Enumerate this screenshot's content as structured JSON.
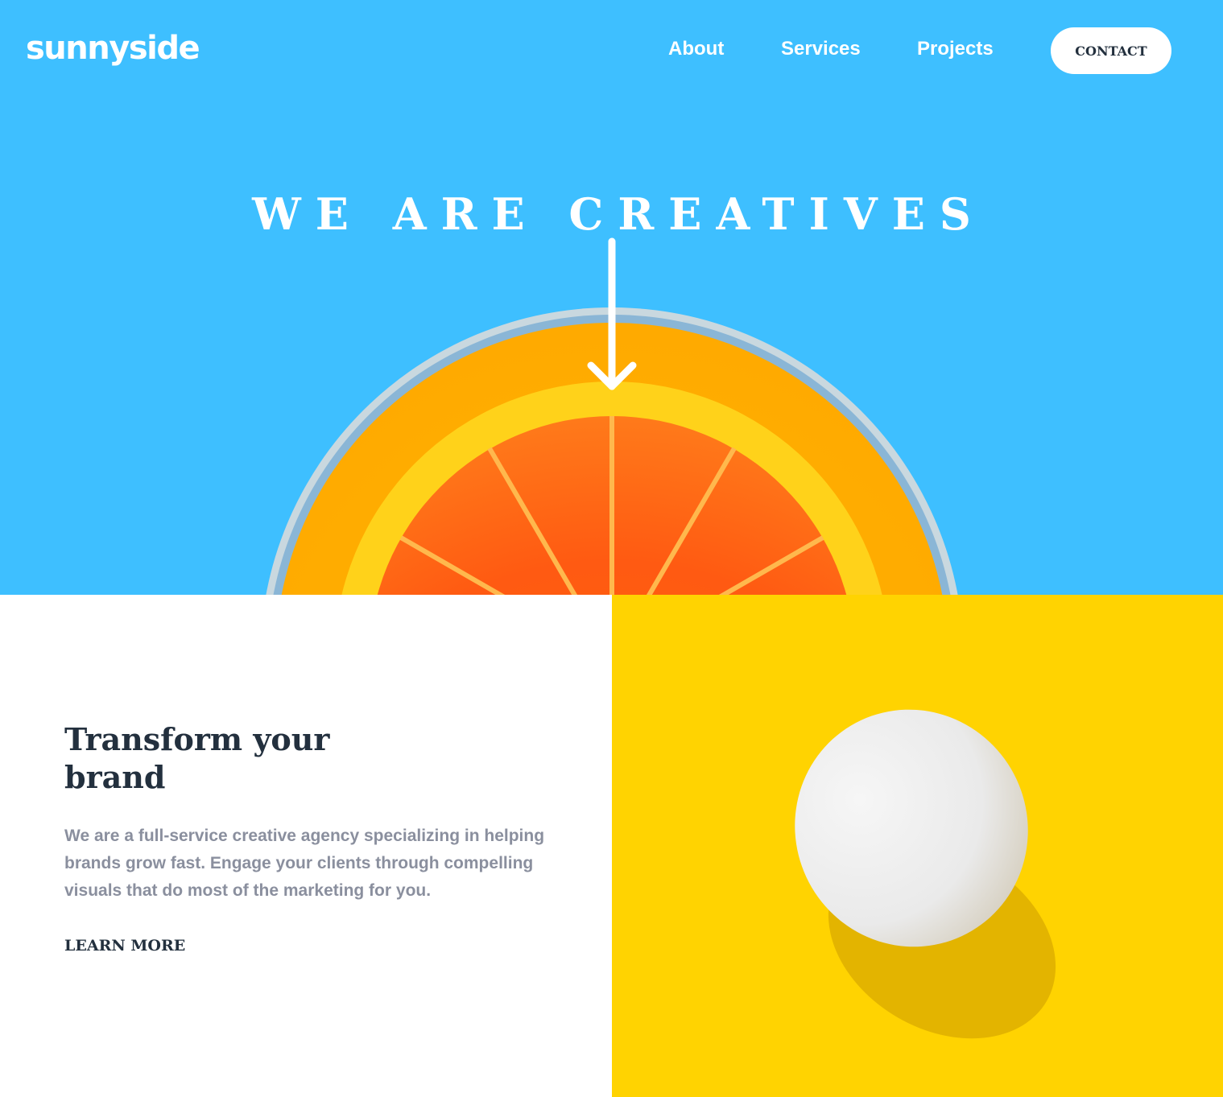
{
  "header": {
    "logo": "sunnyside",
    "nav": {
      "about": "About",
      "services": "Services",
      "projects": "Projects",
      "contact": "CONTACT"
    }
  },
  "hero": {
    "title": "WE ARE CREATIVES",
    "background_color": "#3ebfff",
    "arrow_icon": "arrow-down-icon"
  },
  "feature": {
    "title": "Transform your brand",
    "description": "We are a full-service creative agency specializing in helping brands grow fast. Engage your clients through compelling visuals that do most of the marketing for you.",
    "cta": "LEARN MORE",
    "image_background_color": "#ffd301"
  },
  "colors": {
    "dark_text": "#23303e",
    "muted_text": "#8a8f9e",
    "white": "#ffffff"
  }
}
